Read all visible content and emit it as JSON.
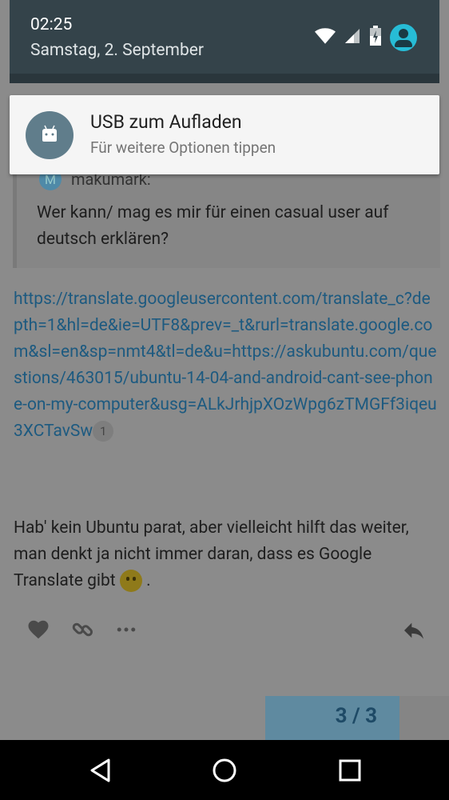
{
  "status": {
    "time": "02:25",
    "date": "Samstag, 2. September"
  },
  "notification": {
    "title": "USB zum Aufladen",
    "subtitle": "Für weitere Optionen tippen",
    "icon": "android-icon"
  },
  "quote": {
    "avatar_letter": "M",
    "username": "makumark:",
    "text": "Wer kann/ mag es mir für einen casual user auf deutsch erklären?"
  },
  "link": {
    "text": "https://translate.googleusercontent.com/translate_c?depth=1&hl=de&ie=UTF8&prev=_t&rurl=translate.google.com&sl=en&sp=nmt4&tl=de&u=https://askubuntu.com/questions/463015/ubuntu-14-04-and-android-cant-see-phone-on-my-computer&usg=ALkJrhjpXOzWpg6zTMGFf3iqeu3XCTavSw",
    "click_count": "1"
  },
  "reply": {
    "text": "Hab' kein Ubuntu parat, aber vielleicht hilft das weiter, man denkt ja nicht immer daran, dass es Google Translate gibt",
    "suffix": " ."
  },
  "progress": {
    "label": "3 / 3"
  },
  "icons": {
    "like": "heart-icon",
    "link": "link-icon",
    "more": "ellipsis-icon",
    "reply": "reply-icon",
    "wifi": "wifi-icon",
    "signal": "signal-icon",
    "battery": "battery-icon",
    "user": "user-icon"
  }
}
